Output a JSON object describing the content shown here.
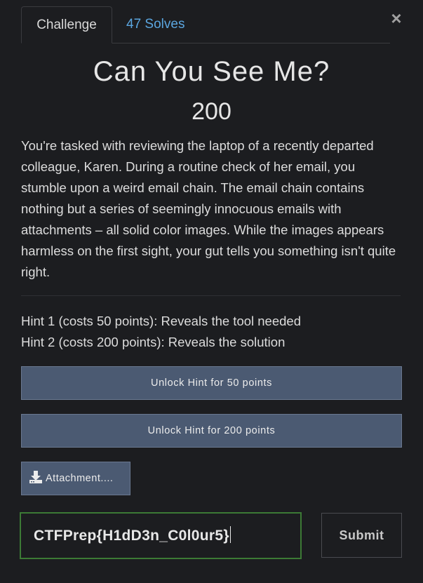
{
  "tabs": {
    "challenge_label": "Challenge",
    "solves_label": "47 Solves"
  },
  "close_symbol": "×",
  "challenge": {
    "title": "Can You See Me?",
    "value": "200",
    "description": "You're tasked with reviewing the laptop of a recently departed colleague, Karen. During a routine check of her email, you stumble upon a weird email chain. The email chain contains nothing but a series of seemingly innocuous emails with attachments – all solid color images. While the images appears harmless on the first sight, your gut tells you something isn't quite right."
  },
  "hints": [
    {
      "text": "Hint 1 (costs 50 points): Reveals the tool needed"
    },
    {
      "text": "Hint 2 (costs 200 points): Reveals the solution"
    }
  ],
  "buttons": {
    "unlock_hint_1": "Unlock Hint for 50 points",
    "unlock_hint_2": "Unlock Hint for 200 points",
    "attachment": "Attachment....",
    "submit": "Submit"
  },
  "flag_input": {
    "value": "CTFPrep{H1dD3n_C0l0ur5}"
  },
  "colors": {
    "background": "#1c1d20",
    "link": "#5ba6e0",
    "button": "#4b5a72",
    "input_border_valid": "#3c7a35"
  },
  "icons": {
    "close": "close-icon",
    "attachment": "download-icon"
  }
}
